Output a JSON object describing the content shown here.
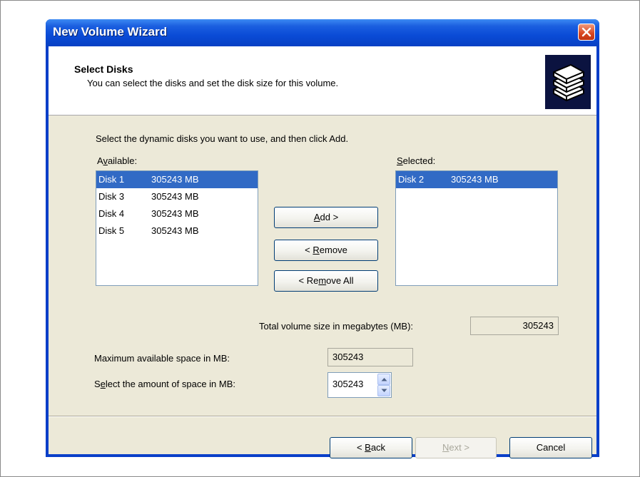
{
  "window": {
    "title": "New Volume Wizard"
  },
  "header": {
    "title": "Select Disks",
    "subtitle": "You can select the disks and set the disk size for this volume.",
    "icon": "disk-stack-icon"
  },
  "instructions": "Select the dynamic disks you want to use, and then click Add.",
  "available": {
    "label_prefix": "A",
    "label_mnemonic": "v",
    "label_suffix": "ailable:",
    "items": [
      {
        "name": "Disk 1",
        "size": "305243 MB",
        "selected": true
      },
      {
        "name": "Disk 3",
        "size": "305243 MB",
        "selected": false
      },
      {
        "name": "Disk 4",
        "size": "305243 MB",
        "selected": false
      },
      {
        "name": "Disk 5",
        "size": "305243 MB",
        "selected": false
      }
    ]
  },
  "selected": {
    "label_mnemonic": "S",
    "label_suffix": "elected:",
    "items": [
      {
        "name": "Disk 2",
        "size": "305243 MB",
        "selected": true
      }
    ]
  },
  "buttons": {
    "add": {
      "mnemonic": "A",
      "suffix": "dd >"
    },
    "remove": {
      "prefix": "< ",
      "mnemonic": "R",
      "suffix": "emove"
    },
    "remove_all": {
      "prefix": "< Re",
      "mnemonic": "m",
      "suffix": "ove All"
    },
    "back": {
      "prefix": "< ",
      "mnemonic": "B",
      "suffix": "ack"
    },
    "next": {
      "mnemonic": "N",
      "suffix": "ext >"
    },
    "cancel": "Cancel"
  },
  "total": {
    "label": "Total volume size in megabytes (MB):",
    "value": "305243"
  },
  "max_space": {
    "label": "Maximum available space in MB:",
    "value": "305243"
  },
  "amount": {
    "label_prefix": "S",
    "label_mnemonic": "e",
    "label_suffix": "lect the amount of space in MB:",
    "value": "305243"
  },
  "colors": {
    "titlebar": "#0a4bd6",
    "dialog_bg": "#ece9d8",
    "selection": "#316ac5",
    "close_button": "#d8451f"
  }
}
